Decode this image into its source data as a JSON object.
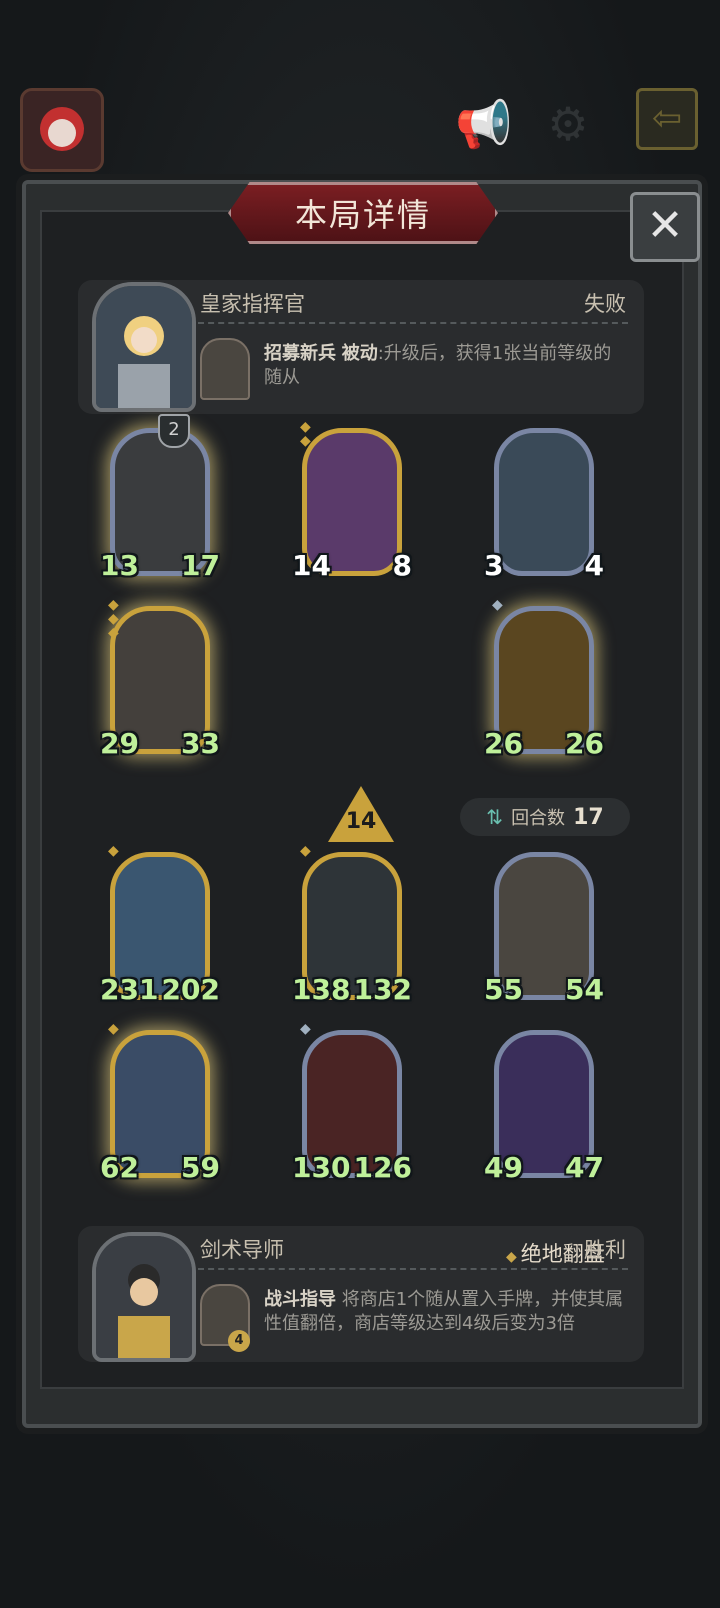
{
  "panel": {
    "title": "本局详情"
  },
  "opponent": {
    "name": "皇家指挥官",
    "result": "失败",
    "skill_name": "招募新兵",
    "skill_type": "被动",
    "skill_desc": ":升级后，获得1张当前等级的随从"
  },
  "opponent_board": [
    {
      "atk": "13",
      "hp": "17",
      "tier": "2",
      "frame": "blue",
      "stars": 0
    },
    {
      "atk": "14",
      "hp": "8",
      "frame": "gold",
      "stars": 2
    },
    {
      "atk": "3",
      "hp": "4",
      "frame": "blue",
      "stars": 0
    },
    {
      "atk": "29",
      "hp": "33",
      "frame": "gold",
      "stars": 3
    },
    {
      "atk": "26",
      "hp": "26",
      "frame": "blue",
      "stars": 1
    }
  ],
  "center_badge": "14",
  "rounds": {
    "label": "回合数",
    "value": "17"
  },
  "player_board": [
    {
      "atk": "231",
      "hp": "202",
      "frame": "gold",
      "stars": 1
    },
    {
      "atk": "138",
      "hp": "132",
      "frame": "gold",
      "stars": 1
    },
    {
      "atk": "55",
      "hp": "54",
      "frame": "blue",
      "stars": 0
    },
    {
      "atk": "62",
      "hp": "59",
      "frame": "gold",
      "stars": 1
    },
    {
      "atk": "130",
      "hp": "126",
      "frame": "blue",
      "stars": 1
    },
    {
      "atk": "49",
      "hp": "47",
      "frame": "blue",
      "stars": 0
    }
  ],
  "player": {
    "name": "剑术导师",
    "special": "绝地翻盘",
    "result": "胜利",
    "skill_name": "战斗指导",
    "skill_desc": " 将商店1个随从置入手牌，并使其属性值翻倍，商店等级达到4级后变为3倍",
    "skill_badge": "4"
  }
}
